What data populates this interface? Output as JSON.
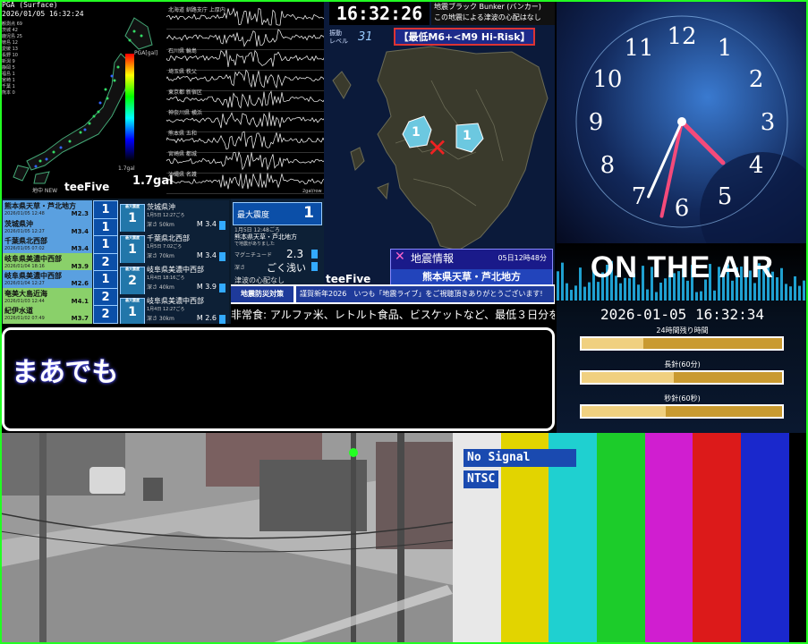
{
  "seismic": {
    "header": "PGA (Surface)\n2026/01/05 16:32:24",
    "legend": [
      "観測点 69",
      "茨城 42",
      "鹿児島 25",
      "徳島 12",
      "愛媛 13",
      "長野 10",
      "新潟 9",
      "静岡 5",
      "福島 1",
      "宮崎 1",
      "千葉 1",
      "熊本 0"
    ],
    "scale_title": "PGA[gal]",
    "gal": "1.7gal",
    "gal_small": "1.7gal",
    "brand": "teeFive",
    "new_label": "地中 NEW",
    "waves": [
      "北海道 釧路支庁 上厚内",
      "",
      "石川県 輪島",
      "埼玉県 秩父",
      "東京都 新宿区",
      "神奈川県 横浜",
      "熊本県 五和",
      "宮崎県 都城",
      "沖縄県 名護"
    ],
    "wave_footer": "2gal/row"
  },
  "quake_list": [
    {
      "name": "熊本県天草・芦北地方",
      "date": "2026/01/05 12:48",
      "mag": "M2.3",
      "int": "1",
      "color": "#5aa0e0"
    },
    {
      "name": "茨城県沖",
      "date": "2026/01/05 12:27",
      "mag": "M3.4",
      "int": "1",
      "color": "#5aa0e0"
    },
    {
      "name": "千葉県北西部",
      "date": "2026/01/05 07:02",
      "mag": "M3.4",
      "int": "1",
      "color": "#5aa0e0"
    },
    {
      "name": "岐阜県美濃中西部",
      "date": "2026/01/04 18:16",
      "mag": "M3.9",
      "int": "2",
      "color": "#8ad06a"
    },
    {
      "name": "岐阜県美濃中西部",
      "date": "2026/01/04 12:27",
      "mag": "M2.6",
      "int": "1",
      "color": "#5aa0e0"
    },
    {
      "name": "奄美大島近海",
      "date": "2026/01/03 12:44",
      "mag": "M4.1",
      "int": "2",
      "color": "#8ad06a"
    },
    {
      "name": "紀伊水道",
      "date": "2026/01/02 07:49",
      "mag": "M3.7",
      "int": "2",
      "color": "#8ad06a"
    }
  ],
  "quake_details": [
    {
      "int": "1",
      "title": "茨城県沖",
      "date": "1月5日 12:27ごろ",
      "depth": "深さ 50km",
      "mag": "M 3.4"
    },
    {
      "int": "1",
      "title": "千葉県北西部",
      "date": "1月5日 7:02ごろ",
      "depth": "深さ 70km",
      "mag": "M 3.4"
    },
    {
      "int": "2",
      "title": "岐阜県美濃中西部",
      "date": "1月4日 18:16ごろ",
      "depth": "深さ 40km",
      "mag": "M 3.9"
    },
    {
      "int": "1",
      "title": "岐阜県美濃中西部",
      "date": "1月4日 12:27ごろ",
      "depth": "深さ 30km",
      "mag": "M 2.6"
    }
  ],
  "detail_small": "最大震度",
  "max_box": {
    "label": "最大震度",
    "value": "1",
    "date": "1月5日 12:48ごろ",
    "region": "熊本県天草・芦北地方",
    "sub": "で地震がありました",
    "mag_label": "マグニチュード",
    "mag": "2.3",
    "depth_label": "深さ",
    "depth": "ごく浅い",
    "tsunami": "津波の心配なし"
  },
  "map": {
    "time": "16:32:26",
    "ticker": "地震ブラック Bunker (バンカー)\nこの地震による津波の心配はなし",
    "risk": "【最低M6+<M9 Hi-Risk】",
    "level_label": "振動\nレベル",
    "level_value": "31",
    "intensity_marks": [
      "1",
      "1"
    ],
    "info_title": "地震情報",
    "info_time": "05日12時48分",
    "info_region": "熊本県天草・芦北地方",
    "brand": "teeFive"
  },
  "banner": {
    "label": "地震防災対策",
    "text": "謹賀新年2026　いつも「地震ライブ」をご視聴頂きありがとうございます!"
  },
  "ticker": "非常食: アルファ米、レトルト食品、ビスケットなど、最低３日分を備蓄",
  "clock": {
    "numbers": [
      "12",
      "1",
      "2",
      "3",
      "4",
      "5",
      "6",
      "7",
      "8",
      "9",
      "10",
      "11"
    ],
    "hour": 4.5,
    "minute": 32,
    "second": 34
  },
  "air": {
    "title": "ON THE AIR",
    "datetime": "2026-01-05 16:32:34",
    "bars": [
      {
        "label": "24時間残り時間",
        "fill": 0.31
      },
      {
        "label": "長針(60分)",
        "fill": 0.46
      },
      {
        "label": "秒針(60秒)",
        "fill": 0.42
      }
    ],
    "colors": {
      "bar": "#c99a30",
      "fill": "#f0d080"
    }
  },
  "subtitle": "まあでも",
  "colorbars": {
    "no_signal": "No Signal",
    "ntsc": "NTSC",
    "colors": [
      "#e8e8e8",
      "#e2d400",
      "#1fd0d0",
      "#1ccc2a",
      "#d01ed0",
      "#dc1a1a",
      "#1a28cc",
      "#000000"
    ]
  }
}
